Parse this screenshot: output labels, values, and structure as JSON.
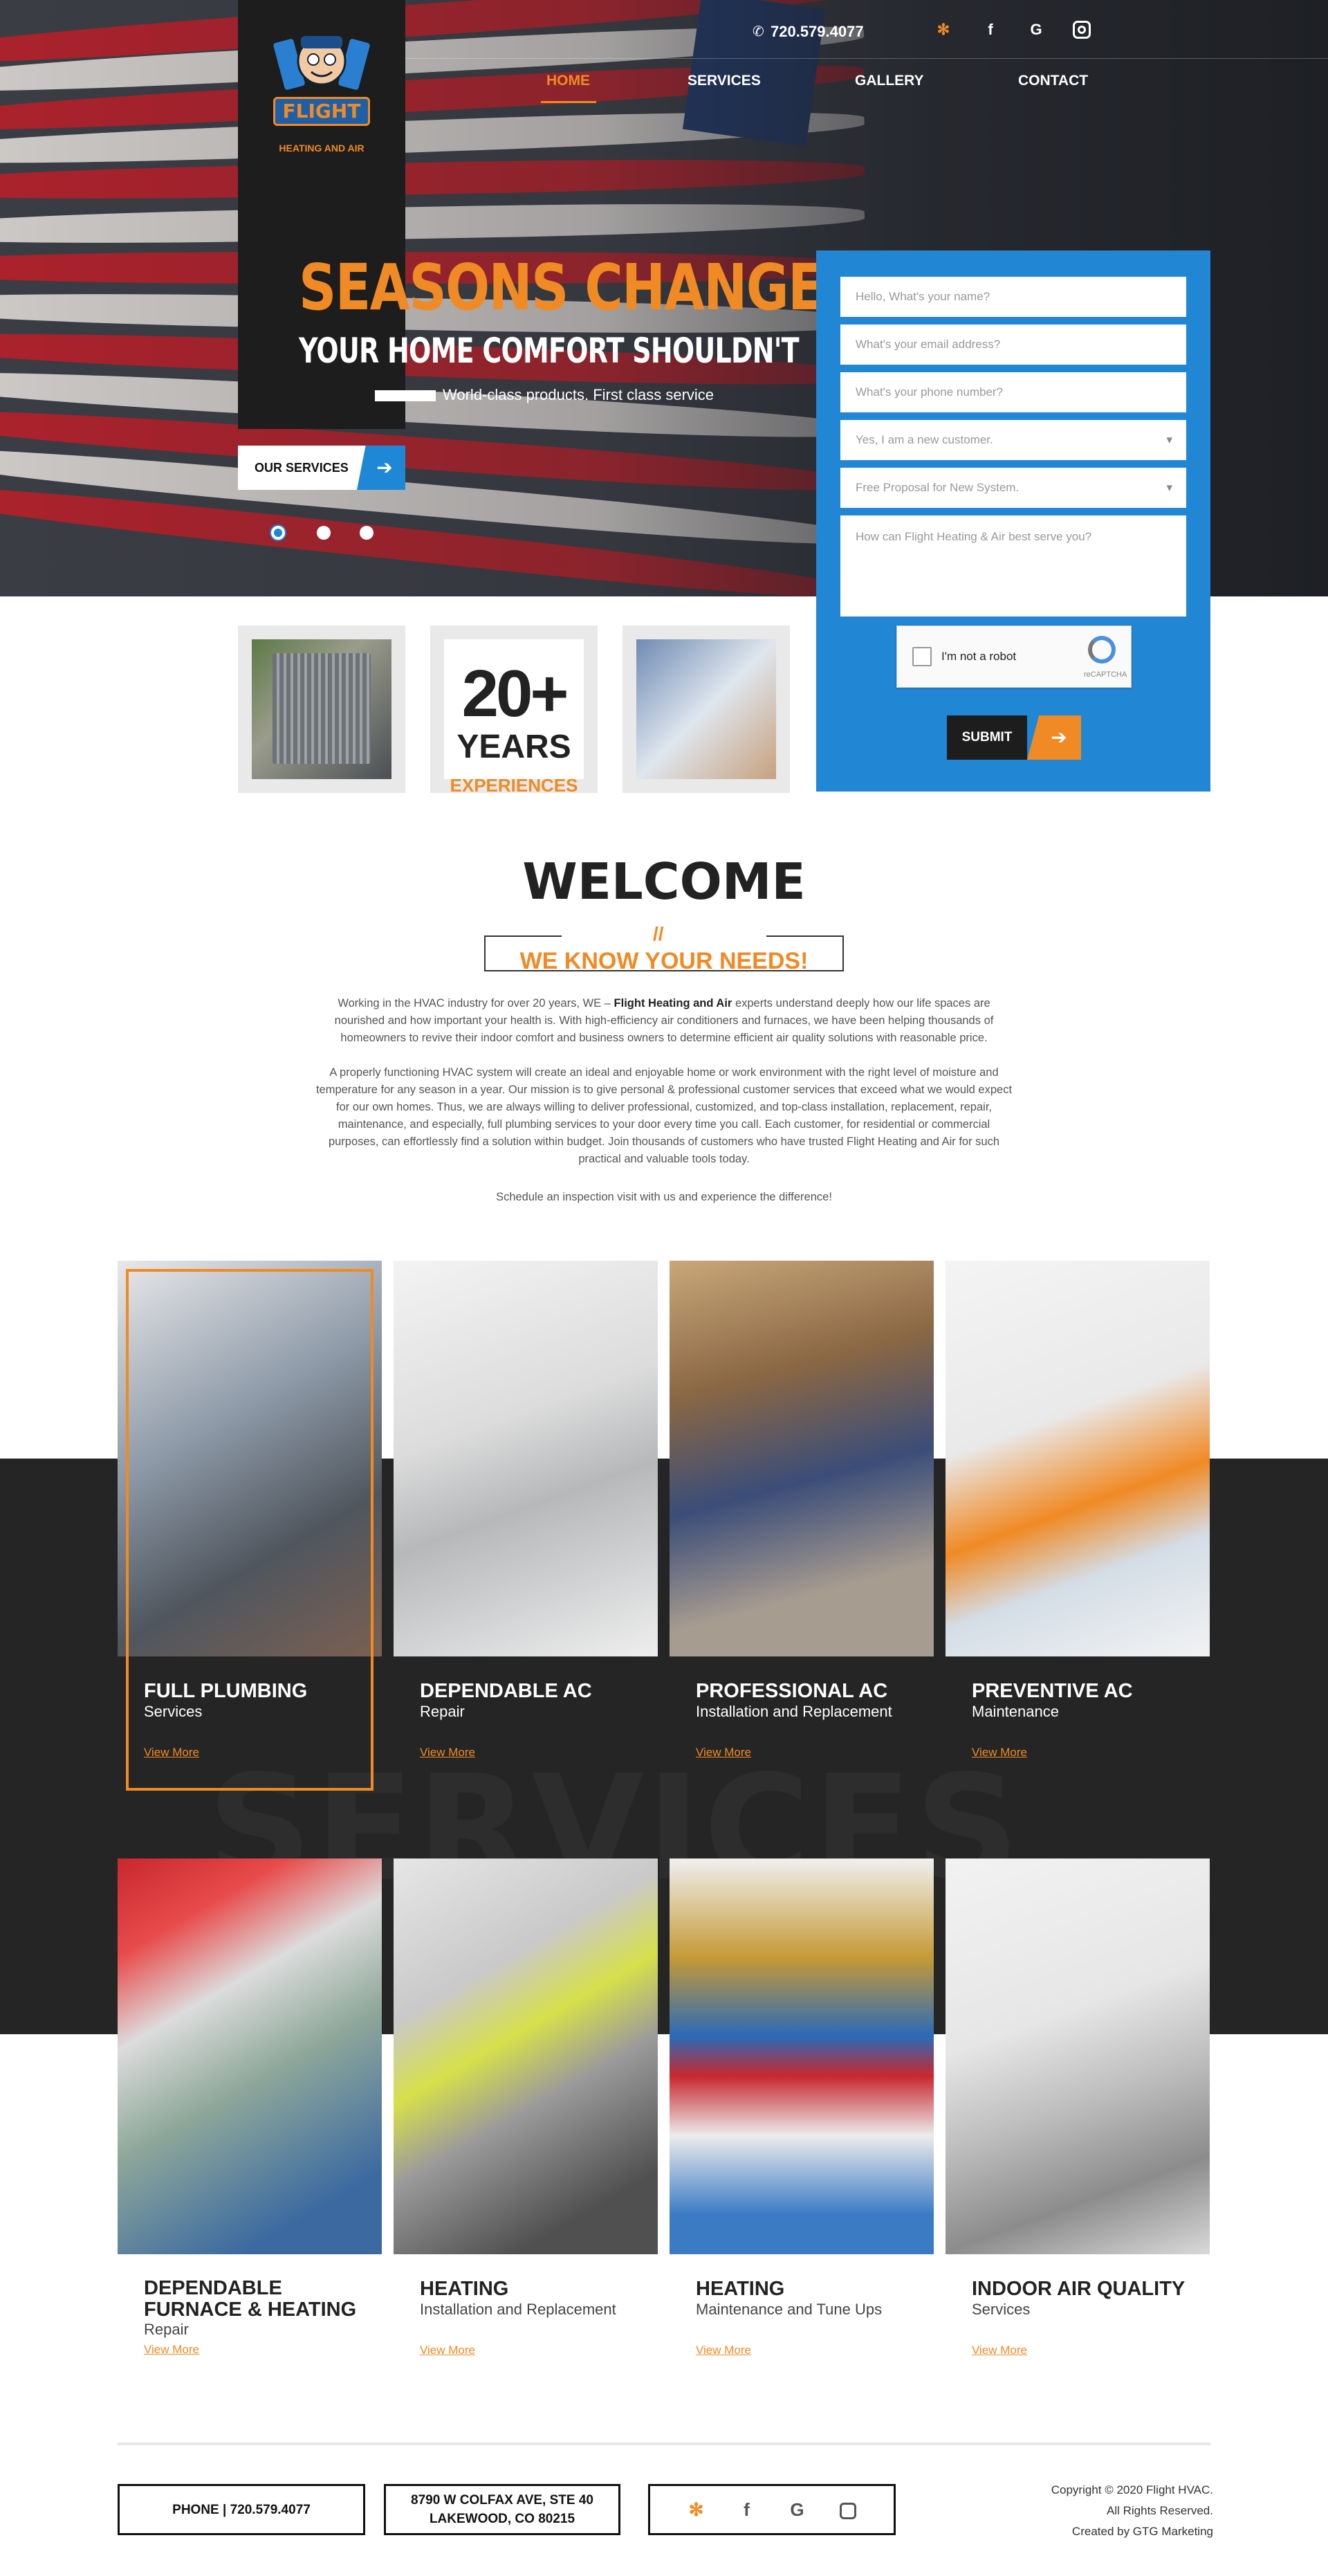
{
  "header": {
    "logo_main": "FLIGHT",
    "logo_sub": "HEATING AND AIR",
    "phone": "720.579.4077",
    "social_icons": [
      "yelp-icon",
      "facebook-icon",
      "google-icon",
      "instagram-icon"
    ],
    "nav": [
      {
        "label": "HOME",
        "active": true
      },
      {
        "label": "SERVICES",
        "active": false
      },
      {
        "label": "GALLERY",
        "active": false
      },
      {
        "label": "CONTACT",
        "active": false
      }
    ]
  },
  "hero": {
    "headline": "SEASONS CHANGE",
    "subheadline": "YOUR HOME COMFORT SHOULDN'T",
    "tagline": "World-class products. First class service",
    "cta": "OUR SERVICES",
    "slides_count": 3,
    "active_slide": 1
  },
  "form": {
    "name_placeholder": "Hello, What's your name?",
    "email_placeholder": "What's your email address?",
    "phone_placeholder": "What's your phone number?",
    "customer_select": "Yes, I am a new customer.",
    "proposal_select": "Free Proposal for New System.",
    "message_placeholder": "How can Flight Heating & Air best serve you?",
    "captcha_label": "I'm not a robot",
    "captcha_brand": "reCAPTCHA",
    "submit": "SUBMIT"
  },
  "badges": {
    "years_number": "20+",
    "years_word": "YEARS",
    "years_caption": "EXPERIENCES"
  },
  "welcome": {
    "title": "WELCOME",
    "hash": "//",
    "subtitle": "WE KNOW YOUR NEEDS!",
    "p1_before": "Working in the HVAC industry for over 20 years, WE – ",
    "p1_bold": "Flight Heating and Air",
    "p1_after": " experts understand deeply how our life spaces are nourished and how important your health is. With high-efficiency air conditioners and furnaces, we have been helping thousands of homeowners to revive their indoor comfort and business owners to determine efficient air quality solutions with reasonable price.",
    "p2": "A properly functioning HVAC system will create an ideal and enjoyable home or work environment with the right level of moisture and temperature for any season in a year. Our mission is to give personal & professional customer services that exceed what we would expect for our own homes. Thus, we are always willing to deliver professional, customized, and top-class installation, replacement, repair, maintenance, and especially, full plumbing services to your door every time you call. Each customer, for residential or commercial purposes, can effortlessly find a solution within budget. Join thousands of customers who have trusted Flight Heating and Air for such practical and valuable tools today.",
    "p3": "Schedule an inspection visit with us and experience the difference!"
  },
  "services_bg_word": "SERVICES",
  "services_row1": [
    {
      "title": "FULL PLUMBING",
      "sub": "Services",
      "more": "View More"
    },
    {
      "title": "DEPENDABLE AC",
      "sub": "Repair",
      "more": "View More"
    },
    {
      "title": "PROFESSIONAL AC",
      "sub": "Installation and Replacement",
      "more": "View More"
    },
    {
      "title": "PREVENTIVE AC",
      "sub": "Maintenance",
      "more": "View More"
    }
  ],
  "services_row2": [
    {
      "title": "DEPENDABLE FURNACE & HEATING",
      "sub": "Repair",
      "more": "View More"
    },
    {
      "title": "HEATING",
      "sub": "Installation and Replacement",
      "more": "View More"
    },
    {
      "title": "HEATING",
      "sub": "Maintenance and Tune Ups",
      "more": "View More"
    },
    {
      "title": "INDOOR AIR QUALITY",
      "sub": "Services",
      "more": "View More"
    }
  ],
  "footer": {
    "phone_label": "PHONE  |  720.579.4077",
    "address_line1": "8790 W COLFAX AVE, STE 40",
    "address_line2": "LAKEWOOD, CO 80215",
    "copyright": "Copyright © 2020 Flight HVAC.",
    "rights": "All Rights Reserved.",
    "credit": "Created by GTG Marketing"
  },
  "colors": {
    "accent": "#f08a24",
    "brand_blue": "#2186d4",
    "dark": "#252525"
  }
}
